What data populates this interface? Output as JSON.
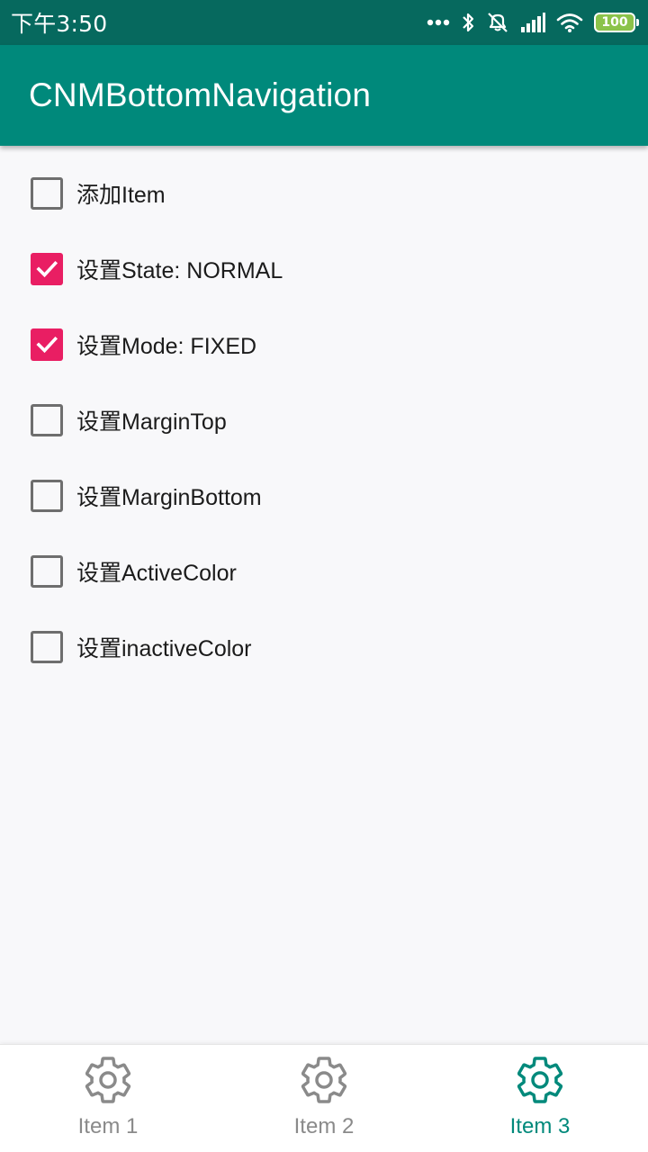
{
  "status_bar": {
    "time": "下午3:50",
    "icons": [
      "more-dots-icon",
      "bluetooth-icon",
      "mute-icon",
      "signal-icon",
      "wifi-icon",
      "battery-icon"
    ],
    "battery_level": "100",
    "battery_color": "#8bc34a",
    "background_color": "#06695e"
  },
  "app_bar": {
    "title": "CNMBottomNavigation",
    "background_color": "#00897b"
  },
  "options": [
    {
      "label": "添加Item",
      "checked": false
    },
    {
      "label": "设置State:  NORMAL",
      "checked": true
    },
    {
      "label": "设置Mode:  FIXED",
      "checked": true
    },
    {
      "label": "设置MarginTop",
      "checked": false
    },
    {
      "label": "设置MarginBottom",
      "checked": false
    },
    {
      "label": "设置ActiveColor",
      "checked": false
    },
    {
      "label": "设置inactiveColor",
      "checked": false
    }
  ],
  "checkbox_checked_color": "#e91e63",
  "bottom_nav": {
    "active_color": "#00897b",
    "inactive_color": "#8a8a8a",
    "items": [
      {
        "label": "Item 1",
        "icon": "settings-gear-icon",
        "active": false
      },
      {
        "label": "Item 2",
        "icon": "settings-gear-icon",
        "active": false
      },
      {
        "label": "Item 3",
        "icon": "settings-gear-icon",
        "active": true
      }
    ]
  }
}
